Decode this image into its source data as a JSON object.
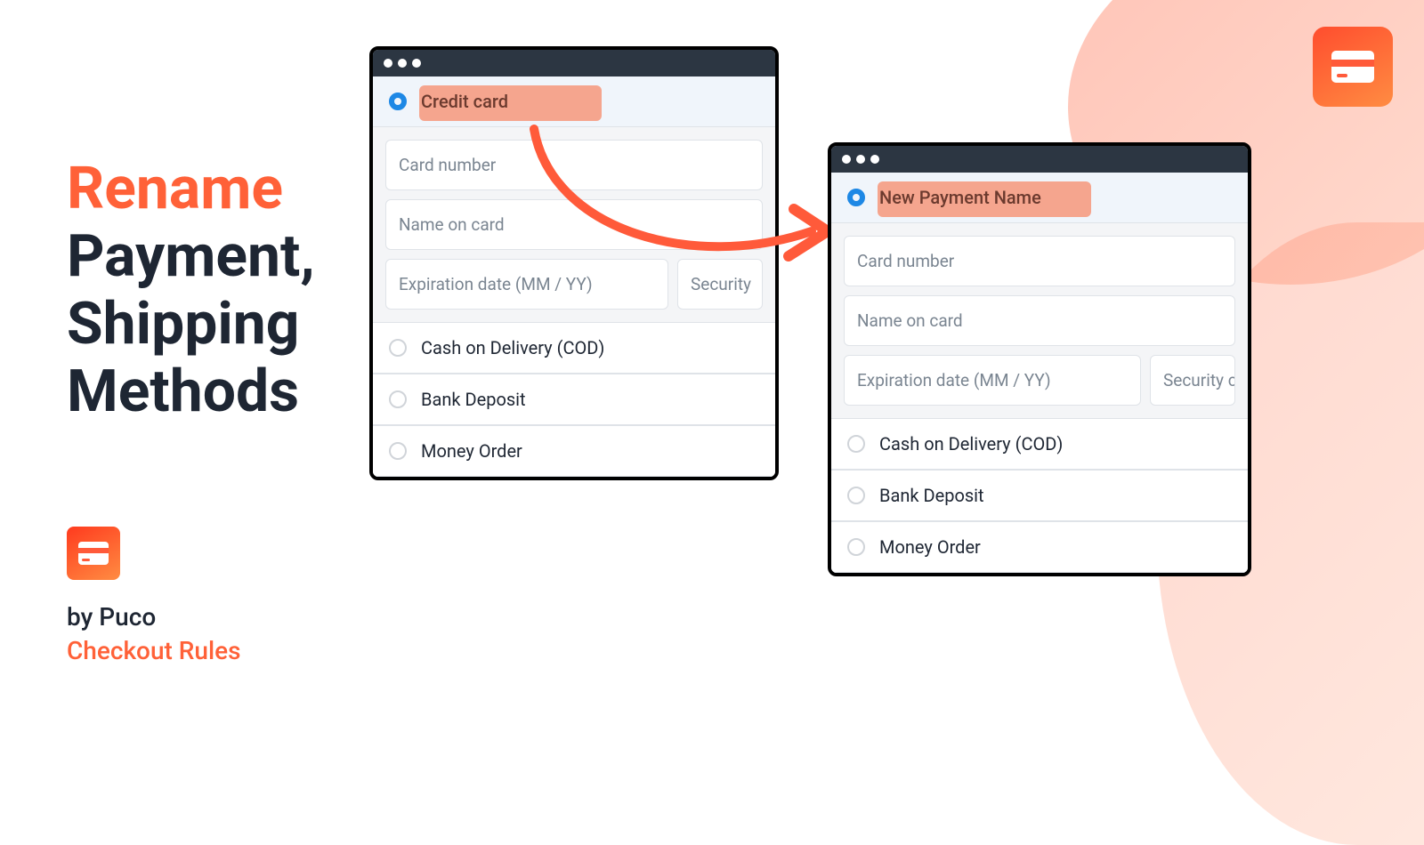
{
  "heading": {
    "line1": "Rename",
    "line2": "Payment,",
    "line3": "Shipping",
    "line4": "Methods"
  },
  "byline": {
    "by": "by Puco",
    "rules": "Checkout Rules"
  },
  "browser1": {
    "selected_label": "Credit card",
    "fields": {
      "card_number": "Card number",
      "name_on_card": "Name on card",
      "expiration": "Expiration date (MM / YY)",
      "security": "Security"
    },
    "options": [
      "Cash on Delivery (COD)",
      "Bank Deposit",
      "Money Order"
    ]
  },
  "browser2": {
    "selected_label": "New Payment Name",
    "fields": {
      "card_number": "Card number",
      "name_on_card": "Name on card",
      "expiration": "Expiration date (MM / YY)",
      "security": "Security c"
    },
    "options": [
      "Cash on Delivery (COD)",
      "Bank Deposit",
      "Money Order"
    ]
  }
}
